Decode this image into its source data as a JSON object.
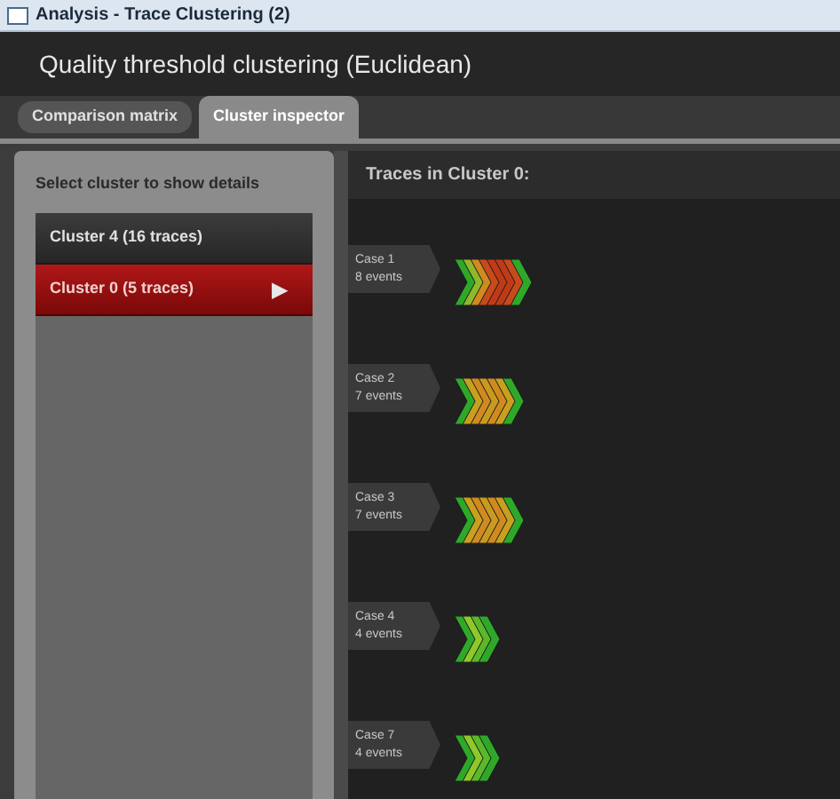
{
  "window": {
    "title": "Analysis - Trace Clustering (2)"
  },
  "header": {
    "title": "Quality threshold clustering (Euclidean)"
  },
  "tabs": [
    {
      "label": "Comparison matrix",
      "selected": false
    },
    {
      "label": "Cluster inspector",
      "selected": true
    }
  ],
  "sidebar": {
    "heading": "Select cluster to show details",
    "items": [
      {
        "label": "Cluster 4 (16 traces)",
        "selected": false
      },
      {
        "label": "Cluster 0 (5 traces)",
        "selected": true,
        "marker": "▶"
      }
    ]
  },
  "traces": {
    "heading": "Traces in Cluster 0:",
    "items": [
      {
        "case": "Case 1",
        "events_label": "8 events",
        "events": [
          {
            "color": "#2fa82a"
          },
          {
            "color": "#8fb82a"
          },
          {
            "color": "#d08a20"
          },
          {
            "color": "#c84a1a"
          },
          {
            "color": "#c03a18"
          },
          {
            "color": "#c03a18"
          },
          {
            "color": "#c84a1a"
          },
          {
            "color": "#2fa82a"
          }
        ]
      },
      {
        "case": "Case 2",
        "events_label": "7 events",
        "events": [
          {
            "color": "#2fa82a"
          },
          {
            "color": "#c8a020"
          },
          {
            "color": "#d08a20"
          },
          {
            "color": "#c89a20"
          },
          {
            "color": "#d08a20"
          },
          {
            "color": "#c8a020"
          },
          {
            "color": "#2fa82a"
          }
        ]
      },
      {
        "case": "Case 3",
        "events_label": "7 events",
        "events": [
          {
            "color": "#2fa82a"
          },
          {
            "color": "#c8a020"
          },
          {
            "color": "#d08a20"
          },
          {
            "color": "#c89a20"
          },
          {
            "color": "#d08a20"
          },
          {
            "color": "#c8a020"
          },
          {
            "color": "#2fa82a"
          }
        ]
      },
      {
        "case": "Case 4",
        "events_label": "4 events",
        "events": [
          {
            "color": "#2fa82a"
          },
          {
            "color": "#8fc82a"
          },
          {
            "color": "#5ab82a"
          },
          {
            "color": "#2fa82a"
          }
        ]
      },
      {
        "case": "Case 7",
        "events_label": "4 events",
        "events": [
          {
            "color": "#2fa82a"
          },
          {
            "color": "#8fc82a"
          },
          {
            "color": "#5ab82a"
          },
          {
            "color": "#2fa82a"
          }
        ]
      }
    ]
  }
}
